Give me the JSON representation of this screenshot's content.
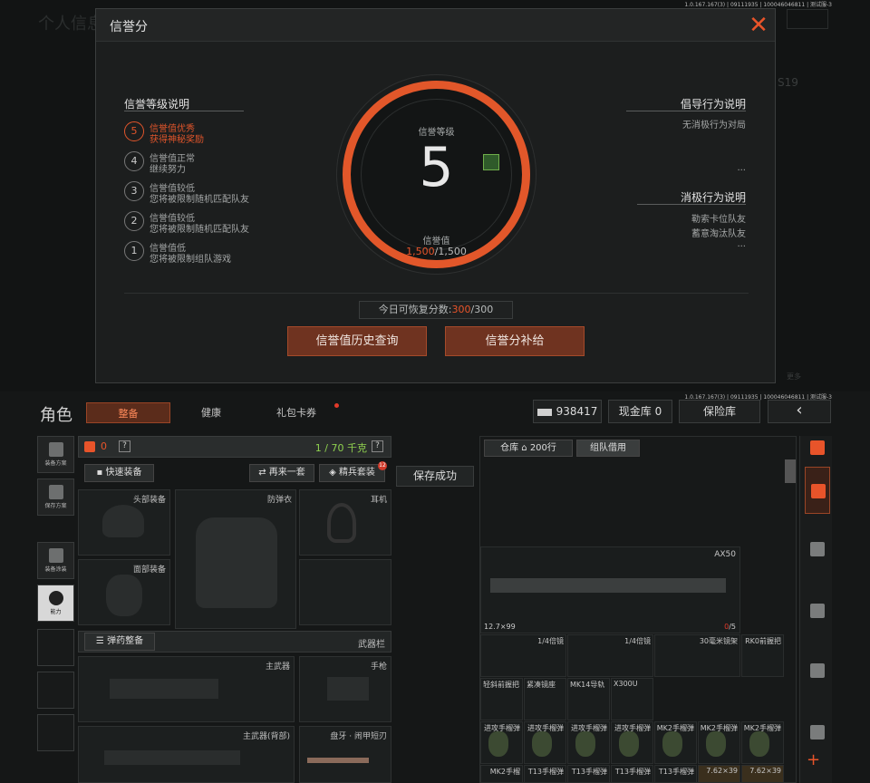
{
  "version": "1.0.167.167(3) | 09111935 | 100046046811 | 测试服-3",
  "modal": {
    "title": "信誉分",
    "close_icon": "close-icon",
    "left_title": "信誉等级说明",
    "levels": [
      {
        "num": "5",
        "line1": "信誉值优秀",
        "line2": "获得神秘奖励",
        "active": true
      },
      {
        "num": "4",
        "line1": "信誉值正常",
        "line2": "继续努力"
      },
      {
        "num": "3",
        "line1": "信誉值较低",
        "line2": "您将被限制随机匹配队友"
      },
      {
        "num": "2",
        "line1": "信誉值较低",
        "line2": "您将被限制随机匹配队友"
      },
      {
        "num": "1",
        "line1": "信誉值低",
        "line2": "您将被限制组队游戏"
      }
    ],
    "center": {
      "level_label": "信誉等级",
      "level_value": "5",
      "score_label": "信誉值",
      "score_current": "1,500",
      "score_max": "/1,500"
    },
    "right": {
      "positive_title": "倡导行为说明",
      "positive_item": "无消极行为对局",
      "positive_more": "...",
      "negative_title": "消极行为说明",
      "negative_items": [
        "勒索卡位队友",
        "蓄意淘汰队友"
      ],
      "negative_more": "..."
    },
    "recover": {
      "label": "今日可恢复分数:",
      "current": "300",
      "max": "/300"
    },
    "buttons": {
      "history": "信誉值历史查询",
      "supplement": "信誉分补给"
    }
  },
  "bg_top": {
    "title": "个人信息",
    "number": "S19",
    "more": "更多"
  },
  "header": {
    "title": "角色",
    "tabs": [
      "整备",
      "健康",
      "礼包卡券"
    ],
    "money": "938417",
    "cash_vault": "现金库 0",
    "safe": "保险库"
  },
  "sidebar": {
    "items": [
      "装备方案",
      "保存方案",
      "装备涂装",
      "能力"
    ]
  },
  "loadout": {
    "armor_count": "0",
    "help": "?",
    "weight": "1 / 70 千克",
    "quick_equip": "快速装备",
    "again": "再来一套",
    "elite": "精兵套装",
    "elite_badge": "12",
    "saved": "保存成功",
    "slots": {
      "helmet": "头部装备",
      "armor": "防弹衣",
      "headset": "耳机",
      "face": "面部装备",
      "ammo": "弹药整备",
      "weapon_bar": "武器栏",
      "primary": "主武器",
      "pistol": "手枪",
      "primary_back": "主武器(背部)",
      "knife": "盘牙 · 闹甲短刃"
    }
  },
  "storage": {
    "tab_warehouse": "仓库",
    "tab_count": "200行",
    "tab_team": "组队借用",
    "weapon": {
      "name": "AX50",
      "ammo": "12.7×99",
      "count_cur": "0",
      "count_max": "/5"
    },
    "attachments": [
      "1/4倍镜",
      "1/4倍镜",
      "30毫米镜架",
      "RK0前握把"
    ],
    "attachments2": [
      "轻斜前握把",
      "紧凑镜座",
      "MK14导轨",
      "X300U"
    ],
    "grenades": [
      "进攻手榴弹",
      "进攻手榴弹",
      "进攻手榴弹",
      "进攻手榴弹",
      "MK2手榴弹",
      "MK2手榴弹",
      "MK2手榴弹"
    ],
    "bottom_row": [
      "MK2手榴",
      "T13手榴弹",
      "T13手榴弹",
      "T13手榴弹",
      "T13手榴弹",
      "7.62×39",
      "7.62×39"
    ]
  },
  "colors": {
    "accent": "#e2572a",
    "green": "#8fd14f"
  }
}
